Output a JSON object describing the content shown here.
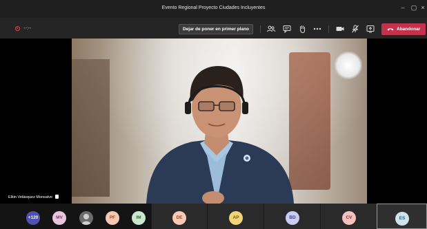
{
  "window": {
    "title": "Evento Regional Proyecto Ciudades Incluyentes",
    "controls": [
      "–",
      "▢",
      "×"
    ]
  },
  "toolbar": {
    "timer": "--:--",
    "unpin_label": "Dejar de poner en primer plano",
    "leave_label": "Abandonar",
    "icons": [
      "participants-icon",
      "chat-icon",
      "raise-hand-icon",
      "more-options-icon",
      "camera-icon",
      "mic-off-icon",
      "share-screen-icon"
    ]
  },
  "stage": {
    "speaker_name": "Elkin Velásquez Monsalve"
  },
  "participants": {
    "overflow_count": "+120",
    "avatars": [
      {
        "initials": "MV",
        "bg": "#e8c7de",
        "fg": "#8a2f6b"
      },
      {
        "initials": "",
        "bg": "#6b6b6b",
        "fg": "#ffffff"
      },
      {
        "initials": "PF",
        "bg": "#f4c6b3",
        "fg": "#a34a1c"
      },
      {
        "initials": "IM",
        "bg": "#cde6cf",
        "fg": "#2f6b35"
      }
    ],
    "tiles": [
      {
        "initials": "DE",
        "bg": "#f7c9b6",
        "fg": "#a3461d"
      },
      {
        "initials": "AP",
        "bg": "#f3d37a",
        "fg": "#7a5a00"
      },
      {
        "initials": "BD",
        "bg": "#c9cdf1",
        "fg": "#3a3f96"
      },
      {
        "initials": "CV",
        "bg": "#f4c0c0",
        "fg": "#9b2b2b"
      },
      {
        "initials": "ES",
        "bg": "#cfe3ef",
        "fg": "#2c5d7a"
      }
    ]
  },
  "colors": {
    "leave_button": "#c4314b",
    "titlebar": "#1f1f1f",
    "toolbar": "#252525"
  }
}
